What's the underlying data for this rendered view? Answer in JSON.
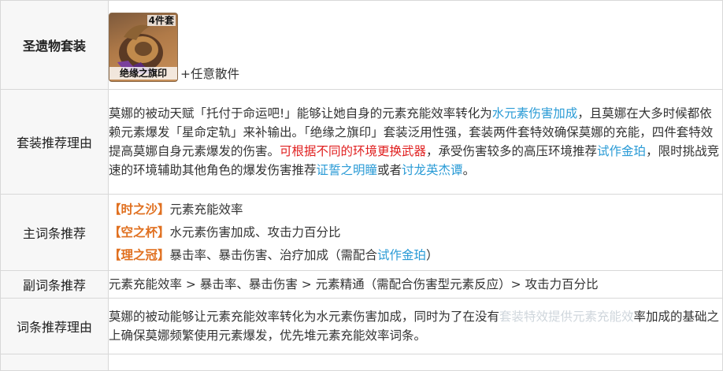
{
  "rows": {
    "set": {
      "label": "圣遗物套装",
      "piece_count": "4件套",
      "set_name": "绝缘之旗印",
      "extra": "+任意散件"
    },
    "reason": {
      "label": "套装推荐理由",
      "t1": "莫娜的被动天赋「托付于命运吧!」能够让她自身的元素充能效率转化为",
      "l1": "水元素伤害加成",
      "t2": "，且莫娜在大多时候都依赖元素爆发「星命定轨」来补输出。「绝缘之旗印」套装泛用性强，套装两件套特效确保莫娜的充能，四件套特效提高莫娜自身元素爆发的伤害。",
      "r1": "可根据不同的环境更换武器",
      "t3": "，承受伤害较多的高压环境推荐",
      "l2": "试作金珀",
      "t4": "，限时挑战竞速的环境辅助其他角色的爆发伤害推荐",
      "l3": "证誓之明瞳",
      "t5": "或者",
      "l4": "讨龙英杰谭",
      "t6": "。"
    },
    "main_stats": {
      "label": "主词条推荐",
      "items": [
        {
          "tag": "【时之沙】",
          "text": "元素充能效率",
          "link": "",
          "tail": ""
        },
        {
          "tag": "【空之杯】",
          "text": "水元素伤害加成、攻击力百分比",
          "link": "",
          "tail": ""
        },
        {
          "tag": "【理之冠】",
          "text": "暴击率、暴击伤害、治疗加成（需配合",
          "link": "试作金珀",
          "tail": "）"
        }
      ]
    },
    "sub_stats": {
      "label": "副词条推荐",
      "text": "元素充能效率 > 暴击率、暴击伤害 > 元素精通（需配合伤害型元素反应）> 攻击力百分比"
    },
    "stat_reason": {
      "label": "词条推荐理由",
      "t1": "莫娜的被动能够让元素充能效率转化为水元素伤害加成，同时为了在没有",
      "overlay": "套装特效提供元素充能效",
      "t2": "率加成的基础之上确保莫娜频繁使用元素爆发，优先堆元素充能效率词条。"
    }
  },
  "colors": {
    "link": "#2a9bd6",
    "warning": "#e02020",
    "tag": "#e07020",
    "label_bg": "#f7f7f7",
    "border": "#d8d8d8"
  },
  "icons": {
    "artifact": "noblesse-oblige-flower-icon"
  }
}
